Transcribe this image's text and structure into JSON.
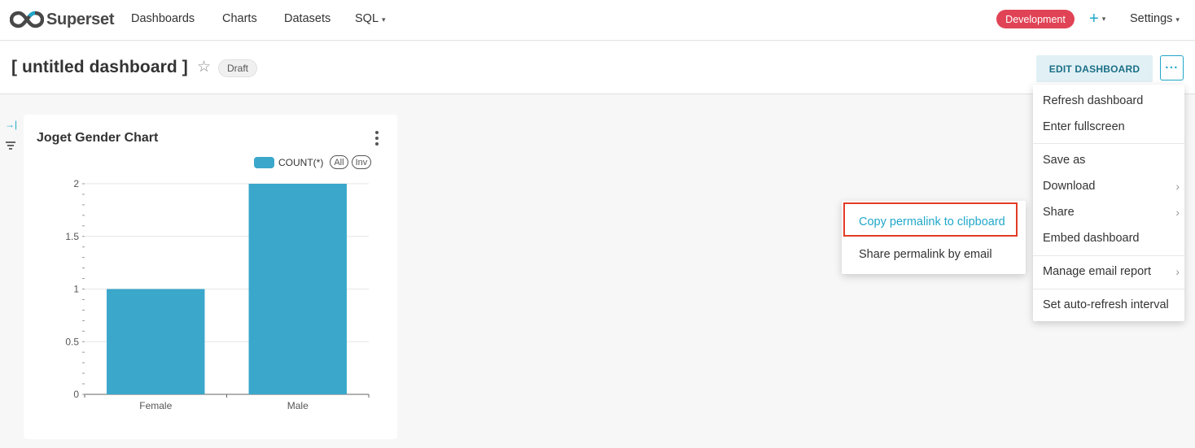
{
  "nav": {
    "brand": "Superset",
    "items": [
      "Dashboards",
      "Charts",
      "Datasets",
      "SQL"
    ],
    "sql_caret": "▾",
    "env_badge": "Development",
    "plus": "+",
    "settings": "Settings",
    "colors": {
      "accent": "#20a7c9",
      "badge": "#e04355"
    }
  },
  "header": {
    "title": "[ untitled dashboard ]",
    "status": "Draft",
    "edit_button": "EDIT DASHBOARD",
    "more_button": "···"
  },
  "chart": {
    "title": "Joget Gender Chart",
    "legend_all": "All",
    "legend_inv": "Inv"
  },
  "chart_data": {
    "type": "bar",
    "categories": [
      "Female",
      "Male"
    ],
    "series": [
      {
        "name": "COUNT(*)",
        "values": [
          1,
          2
        ],
        "color": "#3aa7cb"
      }
    ],
    "ylim": [
      0,
      2
    ],
    "yticks": [
      0,
      0.5,
      1,
      1.5,
      2
    ],
    "grid": true,
    "legend": "top-right"
  },
  "menu": {
    "items": [
      {
        "label": "Refresh dashboard",
        "submenu": false
      },
      {
        "label": "Enter fullscreen",
        "submenu": false
      },
      {
        "label": "Save as",
        "submenu": false
      },
      {
        "label": "Download",
        "submenu": true
      },
      {
        "label": "Share",
        "submenu": true
      },
      {
        "label": "Embed dashboard",
        "submenu": false
      },
      {
        "label": "Manage email report",
        "submenu": true
      },
      {
        "label": "Set auto-refresh interval",
        "submenu": false
      }
    ]
  },
  "share_submenu": {
    "items": [
      {
        "label": "Copy permalink to clipboard",
        "active": true
      },
      {
        "label": "Share permalink by email",
        "active": false
      }
    ]
  }
}
